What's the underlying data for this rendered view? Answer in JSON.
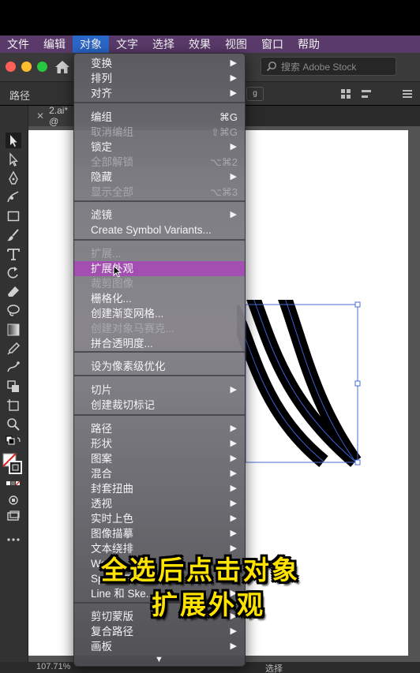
{
  "menubar": {
    "items": [
      "文件",
      "编辑",
      "对象",
      "文字",
      "选择",
      "效果",
      "视图",
      "窗口",
      "帮助"
    ],
    "active_index": 2
  },
  "titlebar": {
    "search_placeholder": "搜索 Adobe Stock"
  },
  "controlbar": {
    "path_label": "路径",
    "dropdown_glyph": "g"
  },
  "document": {
    "tab_label": "2.ai* @",
    "zoom": "107.71%",
    "status_mode": "选择"
  },
  "object_menu": {
    "items": [
      {
        "label": "变换",
        "submenu": true
      },
      {
        "label": "排列",
        "submenu": true
      },
      {
        "label": "对齐",
        "submenu": true
      },
      {
        "label": "编组",
        "shortcut": "⌘G"
      },
      {
        "label": "取消编组",
        "shortcut": "⇧⌘G",
        "disabled": true
      },
      {
        "label": "锁定",
        "submenu": true
      },
      {
        "label": "全部解锁",
        "shortcut": "⌥⌘2",
        "disabled": true
      },
      {
        "label": "隐藏",
        "submenu": true
      },
      {
        "label": "显示全部",
        "shortcut": "⌥⌘3",
        "disabled": true
      },
      {
        "label": "滤镜",
        "submenu": true
      },
      {
        "label": "Create Symbol Variants..."
      },
      {
        "label": "扩展...",
        "disabled": true
      },
      {
        "label": "扩展外观",
        "highlighted": true
      },
      {
        "label": "裁剪图像",
        "disabled": true
      },
      {
        "label": "栅格化..."
      },
      {
        "label": "创建渐变网格..."
      },
      {
        "label": "创建对象马赛克...",
        "disabled": true
      },
      {
        "label": "拼合透明度..."
      },
      {
        "label": "设为像素级优化"
      },
      {
        "label": "切片",
        "submenu": true
      },
      {
        "label": "创建裁切标记"
      },
      {
        "label": "路径",
        "submenu": true
      },
      {
        "label": "形状",
        "submenu": true
      },
      {
        "label": "图案",
        "submenu": true
      },
      {
        "label": "混合",
        "submenu": true
      },
      {
        "label": "封套扭曲",
        "submenu": true
      },
      {
        "label": "透视",
        "submenu": true
      },
      {
        "label": "实时上色",
        "submenu": true
      },
      {
        "label": "图像描摹",
        "submenu": true
      },
      {
        "label": "文本绕排",
        "submenu": true
      },
      {
        "label": "Wo S...",
        "submenu": true
      },
      {
        "label": "Space Fill",
        "submenu": true
      },
      {
        "label": "Line 和 Ske...",
        "submenu": true
      },
      {
        "label": "剪切蒙版",
        "submenu": true
      },
      {
        "label": "复合路径",
        "submenu": true
      },
      {
        "label": "画板",
        "submenu": true
      }
    ],
    "submenu_glyph": "▶",
    "scroll_glyph": "▼"
  },
  "caption": {
    "line1": "全选后点击对象",
    "line2": "扩展外观"
  },
  "colors": {
    "menubar": "#5a3a6a",
    "active_menu": "#2b66c9",
    "highlight": "#a24fb1",
    "caption_text": "#ffe300"
  }
}
